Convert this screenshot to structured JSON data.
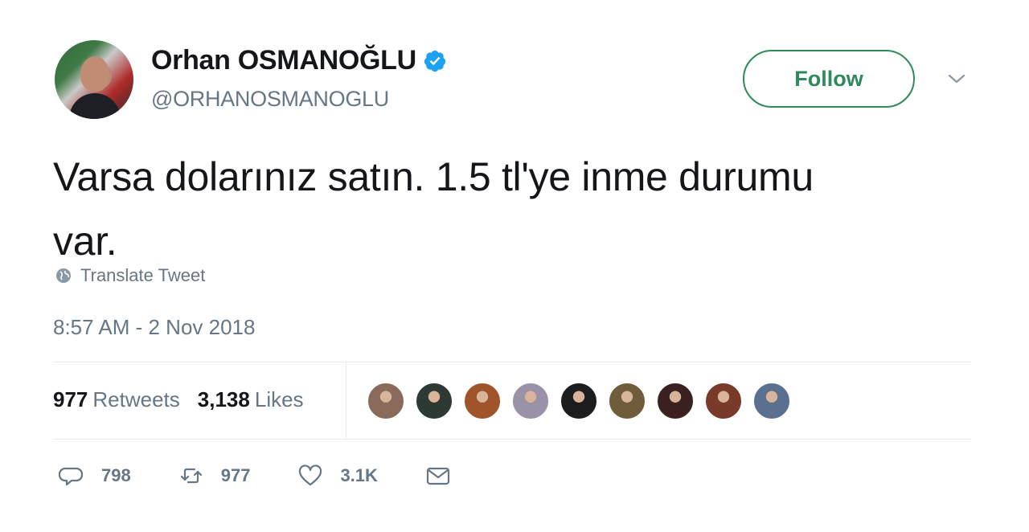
{
  "user": {
    "name": "Orhan OSMANOĞLU",
    "handle": "@ORHANOSMANOGLU"
  },
  "follow_label": "Follow",
  "tweet": {
    "text_line1": "Varsa dolarınız satın. 1.5 tl'ye inme durumu",
    "text_line2": "var.",
    "translate_label": "Translate Tweet",
    "timestamp": "8:57 AM - 2 Nov 2018"
  },
  "stats": {
    "retweets_count": "977",
    "retweets_label": "Retweets",
    "likes_count": "3,138",
    "likes_label": "Likes"
  },
  "likers": [
    {
      "color": "#8a6a5a"
    },
    {
      "color": "#2d3a34"
    },
    {
      "color": "#a0542a"
    },
    {
      "color": "#9a93a8"
    },
    {
      "color": "#1d1d1d"
    },
    {
      "color": "#6e5c3a"
    },
    {
      "color": "#3a2020"
    },
    {
      "color": "#7a3a2a"
    },
    {
      "color": "#5a7090"
    }
  ],
  "actions": {
    "replies": "798",
    "retweets": "977",
    "likes": "3.1K"
  },
  "colors": {
    "accent": "#2e8a5a",
    "verified": "#1da1f2",
    "secondary_text": "#657786"
  }
}
